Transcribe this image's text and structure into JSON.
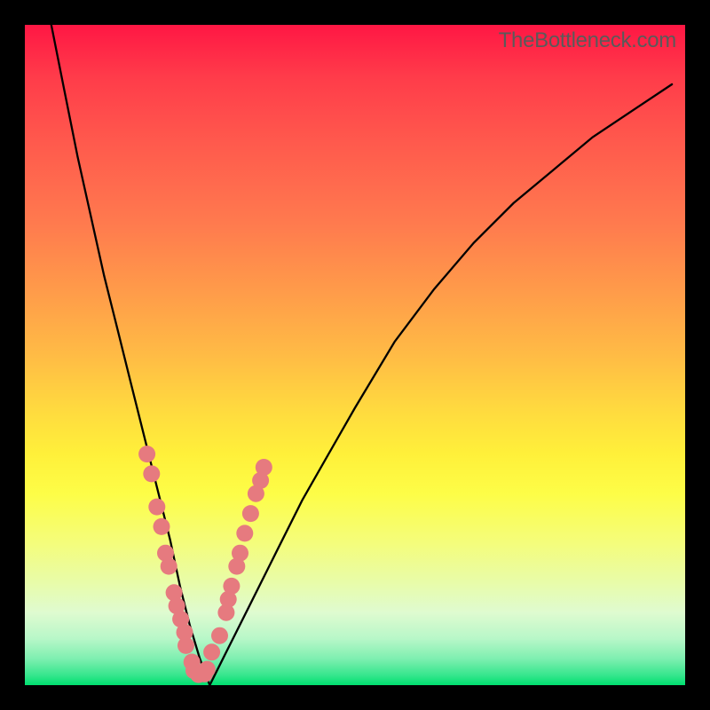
{
  "watermark": "TheBottleneck.com",
  "chart_data": {
    "type": "line",
    "title": "",
    "xlabel": "",
    "ylabel": "",
    "xlim": [
      0,
      100
    ],
    "ylim": [
      0,
      100
    ],
    "series": [
      {
        "name": "bottleneck-curve",
        "x": [
          4,
          6,
          8,
          10,
          12,
          14,
          16,
          18,
          20,
          22,
          23.5,
          25,
          26.5,
          28,
          30,
          34,
          38,
          42,
          46,
          50,
          56,
          62,
          68,
          74,
          80,
          86,
          92,
          98
        ],
        "y": [
          100,
          90,
          80,
          71,
          62,
          54,
          46,
          38,
          30,
          22,
          15,
          9,
          4,
          0,
          4,
          12,
          20,
          28,
          35,
          42,
          52,
          60,
          67,
          73,
          78,
          83,
          87,
          91
        ]
      }
    ],
    "markers": {
      "name": "highlight-beads",
      "points": [
        {
          "x": 18.5,
          "y": 35
        },
        {
          "x": 19.2,
          "y": 32
        },
        {
          "x": 20.0,
          "y": 27
        },
        {
          "x": 20.7,
          "y": 24
        },
        {
          "x": 21.3,
          "y": 20
        },
        {
          "x": 21.8,
          "y": 18
        },
        {
          "x": 22.6,
          "y": 14
        },
        {
          "x": 23.0,
          "y": 12
        },
        {
          "x": 23.6,
          "y": 10
        },
        {
          "x": 24.2,
          "y": 8
        },
        {
          "x": 24.4,
          "y": 6
        },
        {
          "x": 25.3,
          "y": 3.5
        },
        {
          "x": 25.6,
          "y": 2.2
        },
        {
          "x": 26.3,
          "y": 1.6
        },
        {
          "x": 27.2,
          "y": 1.7
        },
        {
          "x": 27.6,
          "y": 2.4
        },
        {
          "x": 28.3,
          "y": 5
        },
        {
          "x": 29.5,
          "y": 7.5
        },
        {
          "x": 30.5,
          "y": 11
        },
        {
          "x": 30.8,
          "y": 13
        },
        {
          "x": 31.3,
          "y": 15
        },
        {
          "x": 32.1,
          "y": 18
        },
        {
          "x": 32.6,
          "y": 20
        },
        {
          "x": 33.3,
          "y": 23
        },
        {
          "x": 34.2,
          "y": 26
        },
        {
          "x": 35.0,
          "y": 29
        },
        {
          "x": 35.7,
          "y": 31
        },
        {
          "x": 36.2,
          "y": 33
        }
      ]
    },
    "gradient_stops": [
      {
        "pos": 0,
        "color": "#ff1744"
      },
      {
        "pos": 50,
        "color": "#ffbb45"
      },
      {
        "pos": 75,
        "color": "#fdfd47"
      },
      {
        "pos": 100,
        "color": "#00df6f"
      }
    ]
  }
}
